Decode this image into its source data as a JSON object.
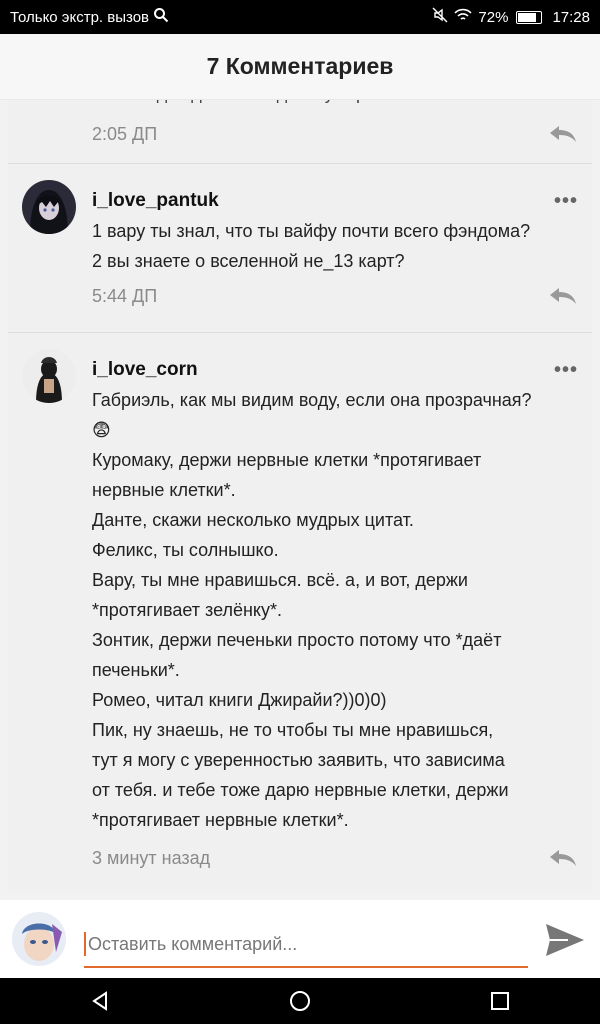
{
  "status_bar": {
    "carrier": "Только экстр. вызов",
    "battery": "72%",
    "time": "17:28"
  },
  "header": {
    "title": "7 Комментариев"
  },
  "comments": [
    {
      "username": "",
      "lines": [
        "Шоколада сделала вид что умирает"
      ],
      "time": "2:05 ДП"
    },
    {
      "username": "i_love_pantuk",
      "lines": [
        "1 вару ты знал, что ты вайфу почти всего фэндома?",
        "2 вы знаете о вселенной не_13 карт?"
      ],
      "time": "5:44 ДП"
    },
    {
      "username": "i_love_corn",
      "lines": [
        "Габриэль, как мы видим воду, если она прозрачная?",
        "😨",
        "Куромаку, держи нервные клетки *протягивает",
        "нервные клетки*.",
        "Данте, скажи несколько мудрых цитат.",
        "Феликс, ты солнышко.",
        "Вару, ты мне нравишься. всё. а, и вот, держи",
        "*протягивает зелёнку*.",
        "Зонтик, держи печеньки просто потому что *даёт",
        "печеньки*.",
        "Ромео, читал книги Джирайи?))0)0)",
        "Пик, ну знаешь, не то чтобы ты мне нравишься,",
        "тут я могу с уверенностью заявить, что зависима",
        "от тебя. и тебе тоже дарю нервные клетки, держи",
        "*протягивает нервные клетки*."
      ],
      "time": "3 минут назад"
    }
  ],
  "input": {
    "placeholder": "Оставить комментарий..."
  },
  "colors": {
    "accent": "#e06a2c"
  }
}
